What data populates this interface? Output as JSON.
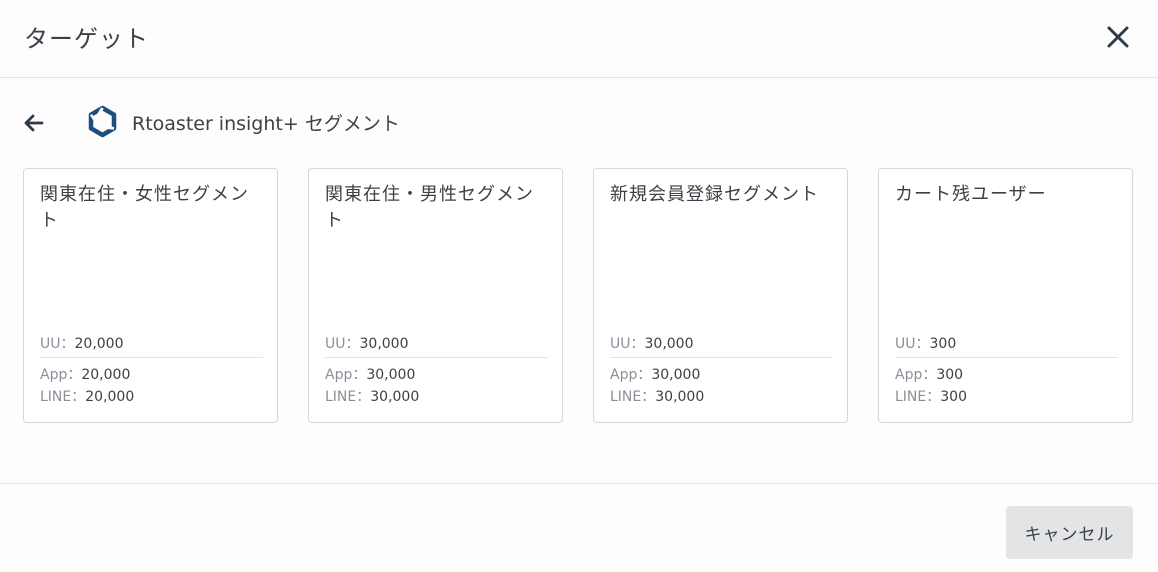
{
  "dialog": {
    "title": "ターゲット",
    "close_icon": "close-icon"
  },
  "breadcrumb": {
    "back_icon": "arrow-left-icon",
    "brand_icon": "rtoaster-logo-icon",
    "label": "Rtoaster insight+ セグメント"
  },
  "segments": [
    {
      "title": "関東在住・女性セグメント",
      "uu_label": "UU",
      "uu": "20,000",
      "app_label": "App",
      "app": "20,000",
      "line_label": "LINE",
      "line": "20,000"
    },
    {
      "title": "関東在住・男性セグメント",
      "uu_label": "UU",
      "uu": "30,000",
      "app_label": "App",
      "app": "30,000",
      "line_label": "LINE",
      "line": "30,000"
    },
    {
      "title": "新規会員登録セグメント",
      "uu_label": "UU",
      "uu": "30,000",
      "app_label": "App",
      "app": "30,000",
      "line_label": "LINE",
      "line": "30,000"
    },
    {
      "title": "カート残ユーザー",
      "uu_label": "UU",
      "uu": "300",
      "app_label": "App",
      "app": "300",
      "line_label": "LINE",
      "line": "300"
    }
  ],
  "separator": "：",
  "footer": {
    "cancel_label": "キャンセル"
  },
  "colors": {
    "brand": "#1d4f7c",
    "text": "#3d4147",
    "muted": "#8a9099",
    "button_bg": "#e3e4e6"
  }
}
